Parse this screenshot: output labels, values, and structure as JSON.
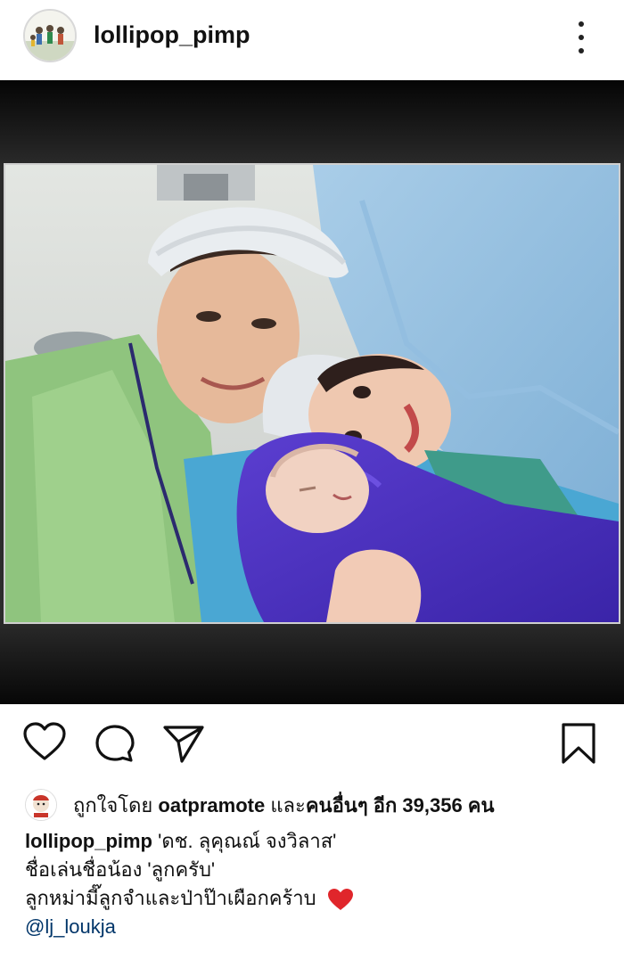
{
  "post": {
    "username": "lollipop_pimp",
    "more_icon": "more-vertical-icon"
  },
  "actions": {
    "like_icon": "heart-outline-icon",
    "comment_icon": "comment-icon",
    "share_icon": "send-icon",
    "save_icon": "bookmark-icon"
  },
  "likes": {
    "prefix": "ถูกใจโดย",
    "user": "oatpramote",
    "middle": "และ",
    "others": "คนอื่นๆ อีก 39,356 คน"
  },
  "caption": {
    "username": "lollipop_pimp",
    "line1": "'ดช. ลุคุณณ์ จงวิลาส'",
    "line2": "ชื่อเล่นชื่อน้อง 'ลูกครับ'",
    "line3": "ลูกหม่ามี๊ลูกจำและป่าป๊าเผือกคร้าบ",
    "mention": "@lj_loukja"
  },
  "colors": {
    "text": "#111111",
    "mention": "#003569",
    "heart": "#e0262b"
  }
}
